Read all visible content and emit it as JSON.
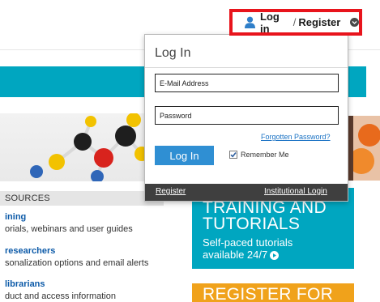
{
  "header": {
    "login_label": "Log in",
    "separator": "/",
    "register_label": "Register"
  },
  "login_panel": {
    "title": "Log In",
    "email_placeholder": "E-Mail Address",
    "password_placeholder": "Password",
    "forgot_password": "Forgotten Password?",
    "login_button": "Log In",
    "remember_me": "Remember Me",
    "remember_checked": true,
    "register_link": "Register",
    "institutional_login": "Institutional Login"
  },
  "resources": {
    "header": "SOURCES",
    "items": [
      {
        "title": "ining",
        "desc": "orials, webinars and user guides"
      },
      {
        "title": "researchers",
        "desc": "sonalization options and email alerts"
      },
      {
        "title": "librarians",
        "desc": "duct and access information"
      }
    ]
  },
  "promos": {
    "training_line1": "TRAINING AND",
    "training_line2": "TUTORIALS",
    "training_sub1": "Self-paced tutorials",
    "training_sub2": "available 24/7",
    "register_banner": "REGISTER FOR"
  },
  "icons": {
    "user": "user-icon",
    "chevron": "chevron-down-icon",
    "play": "play-icon",
    "check": "check-icon"
  },
  "colors": {
    "highlight_border": "#e8141c",
    "teal": "#00a6c0",
    "button_blue": "#2f8fd3",
    "link_blue": "#1a72c4",
    "footer_bg": "#3f3f3f",
    "yellow": "#f0a21b"
  }
}
